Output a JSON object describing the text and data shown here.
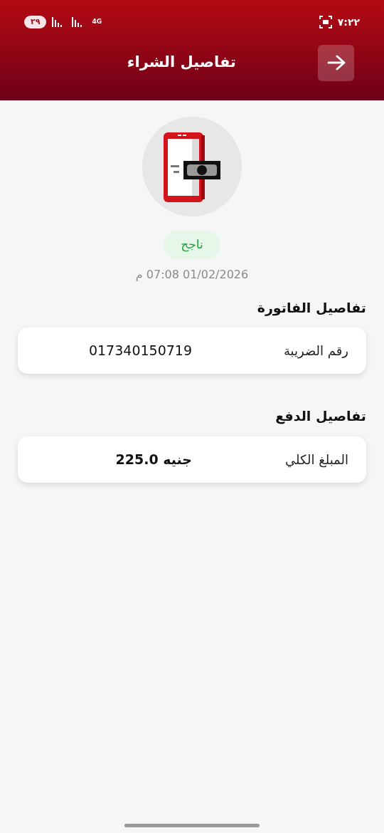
{
  "status_bar": {
    "time": "٧:٢٢",
    "battery": "٢٩",
    "network": "4G"
  },
  "header": {
    "title": "تفاصيل الشراء"
  },
  "status": {
    "label": "ناجح",
    "kind": "success"
  },
  "date": "01/02/2026 07:08 م",
  "sections": [
    {
      "title": "تفاصيل الفاتورة",
      "rows": [
        {
          "label": "رقم الضريبة",
          "value": "017340150719",
          "bold": false
        }
      ]
    },
    {
      "title": "تفاصيل الدفع",
      "rows": [
        {
          "label": "المبلغ الكلي",
          "value": "جنيه 225.0",
          "bold": true
        }
      ]
    }
  ]
}
